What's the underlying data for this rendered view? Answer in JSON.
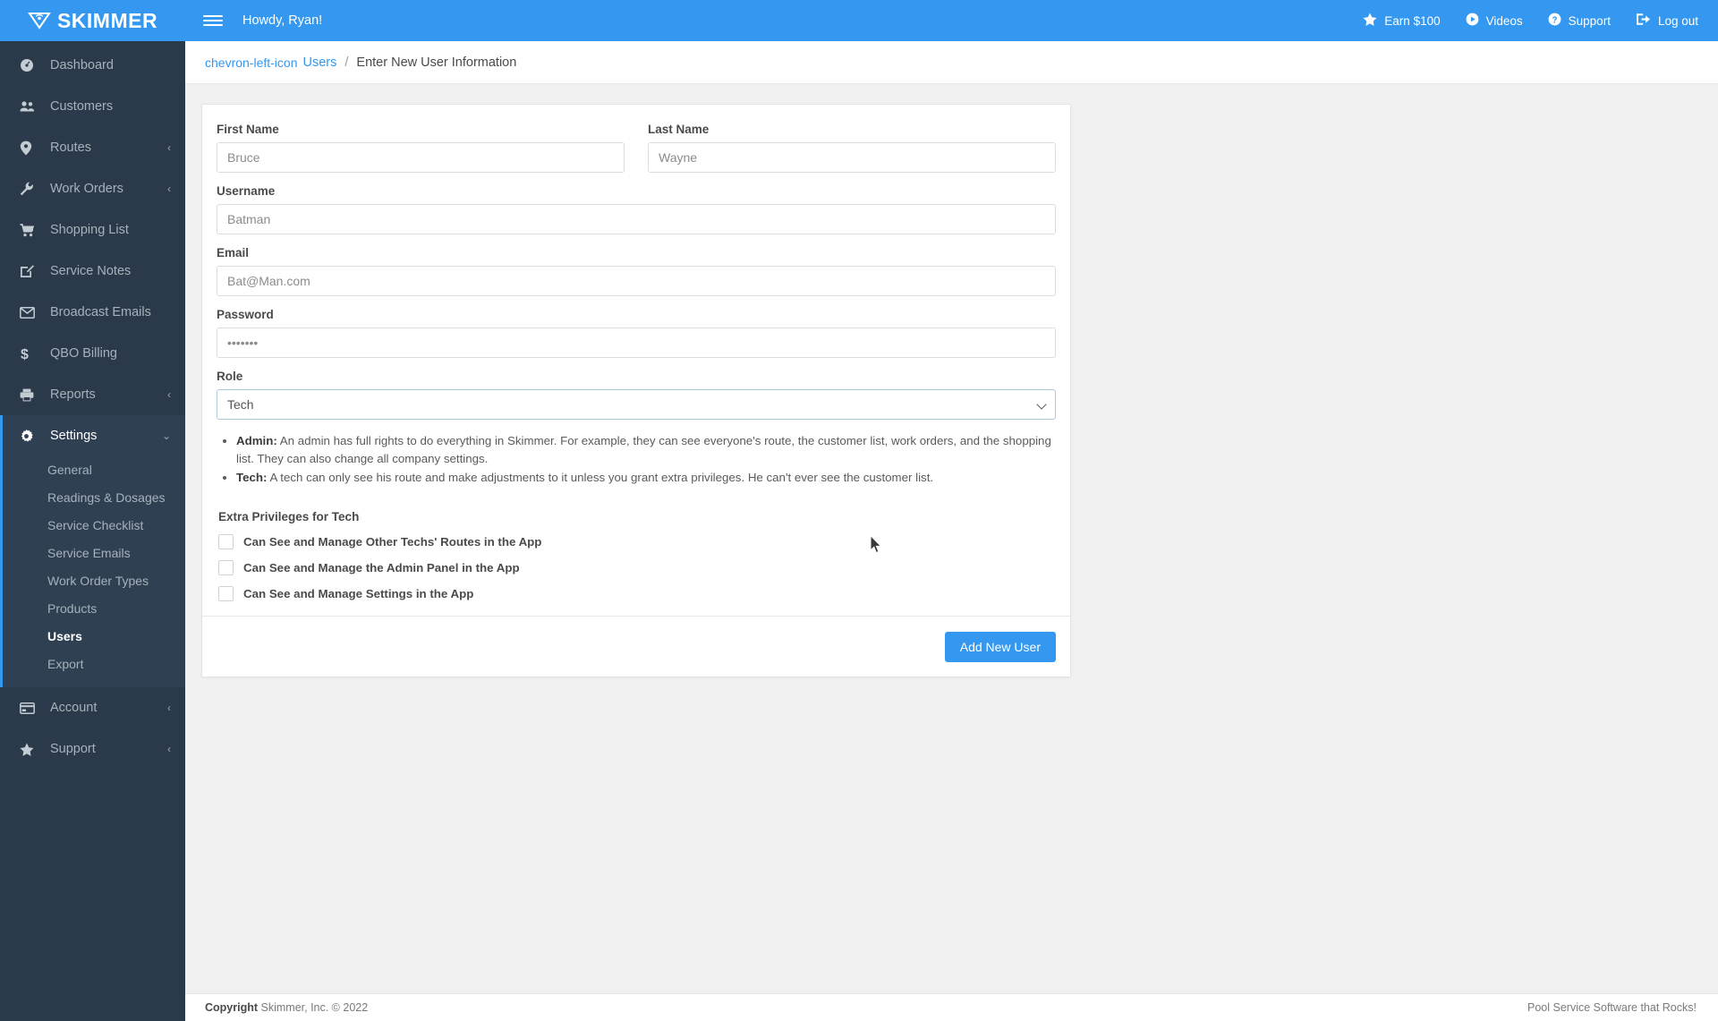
{
  "brand": {
    "name": "SKIMMER",
    "logo_icon": "skimmer-drop-icon"
  },
  "topbar": {
    "menu_icon": "hamburger-icon",
    "greeting": "Howdy, Ryan!",
    "links": [
      {
        "label": "Earn $100",
        "icon": "star-icon"
      },
      {
        "label": "Videos",
        "icon": "play-circle-icon"
      },
      {
        "label": "Support",
        "icon": "question-circle-icon"
      },
      {
        "label": "Log out",
        "icon": "logout-icon"
      }
    ]
  },
  "breadcrumb": {
    "back_icon": "chevron-left-icon",
    "parent": "Users",
    "separator": "/",
    "current": "Enter New User Information"
  },
  "sidebar": {
    "items": [
      {
        "label": "Dashboard",
        "icon": "dashboard-icon",
        "chevron": ""
      },
      {
        "label": "Customers",
        "icon": "customers-icon",
        "chevron": ""
      },
      {
        "label": "Routes",
        "icon": "map-pin-icon",
        "chevron": "‹"
      },
      {
        "label": "Work Orders",
        "icon": "wrench-icon",
        "chevron": "‹"
      },
      {
        "label": "Shopping List",
        "icon": "cart-icon",
        "chevron": ""
      },
      {
        "label": "Service Notes",
        "icon": "note-edit-icon",
        "chevron": ""
      },
      {
        "label": "Broadcast Emails",
        "icon": "envelope-icon",
        "chevron": ""
      },
      {
        "label": "QBO Billing",
        "icon": "dollar-icon",
        "chevron": ""
      },
      {
        "label": "Reports",
        "icon": "printer-icon",
        "chevron": "‹"
      }
    ],
    "settings": {
      "label": "Settings",
      "icon": "gear-icon",
      "chevron": "⌄",
      "sub_items": [
        {
          "label": "General",
          "current": false
        },
        {
          "label": "Readings & Dosages",
          "current": false
        },
        {
          "label": "Service Checklist",
          "current": false
        },
        {
          "label": "Service Emails",
          "current": false
        },
        {
          "label": "Work Order Types",
          "current": false
        },
        {
          "label": "Products",
          "current": false
        },
        {
          "label": "Users",
          "current": true
        },
        {
          "label": "Export",
          "current": false
        }
      ]
    },
    "bottom_items": [
      {
        "label": "Account",
        "icon": "credit-card-icon",
        "chevron": "‹"
      },
      {
        "label": "Support",
        "icon": "star-icon",
        "chevron": "‹"
      }
    ]
  },
  "form": {
    "first_name": {
      "label": "First Name",
      "value": "Bruce",
      "placeholder": "First Name"
    },
    "last_name": {
      "label": "Last Name",
      "value": "Wayne",
      "placeholder": "Last Name"
    },
    "username": {
      "label": "Username",
      "value": "Batman",
      "placeholder": "Username"
    },
    "email": {
      "label": "Email",
      "value": "Bat@Man.com",
      "placeholder": "Email"
    },
    "password": {
      "label": "Password",
      "value": "•••••••",
      "placeholder": "Password"
    },
    "role": {
      "label": "Role",
      "selected": "Tech",
      "options": [
        "Admin",
        "Tech"
      ]
    },
    "role_notes": [
      {
        "term": "Admin:",
        "text": " An admin has full rights to do everything in Skimmer. For example, they can see everyone's route, the customer list, work orders, and the shopping list. They can also change all company settings."
      },
      {
        "term": "Tech:",
        "text": " A tech can only see his route and make adjustments to it unless you grant extra privileges. He can't ever see the customer list."
      }
    ],
    "privileges": {
      "title": "Extra Privileges for Tech",
      "items": [
        {
          "label": "Can See and Manage Other Techs' Routes in the App",
          "checked": false
        },
        {
          "label": "Can See and Manage the Admin Panel in the App",
          "checked": false
        },
        {
          "label": "Can See and Manage Settings in the App",
          "checked": false
        }
      ]
    },
    "submit_label": "Add New User"
  },
  "footer": {
    "copyright_bold": "Copyright",
    "copyright_text": " Skimmer, Inc. © 2022",
    "tagline": "Pool Service Software that Rocks!"
  },
  "colors": {
    "brand_blue": "#3498f0",
    "sidebar_dark": "#2b3a4a",
    "sidebar_active": "#2f4053",
    "select_border": "#a8cedd"
  }
}
